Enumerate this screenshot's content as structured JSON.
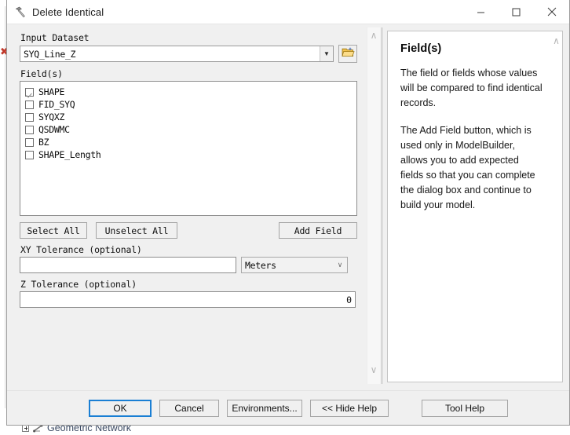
{
  "window": {
    "title": "Delete Identical",
    "icon": "hammer-tool-icon",
    "minimize_label": "—",
    "maximize_label": "☐",
    "close_label": "✕"
  },
  "parameters": {
    "input_dataset": {
      "label": "Input Dataset",
      "value": "SYQ_Line_Z",
      "placeholder": "",
      "browse_icon": "open-folder-icon",
      "caret": "▼"
    },
    "fields": {
      "label": "Field(s)",
      "items": [
        {
          "name": "SHAPE",
          "checked": true
        },
        {
          "name": "FID_SYQ",
          "checked": false
        },
        {
          "name": "SYQXZ",
          "checked": false
        },
        {
          "name": "QSDWMC",
          "checked": false
        },
        {
          "name": "BZ",
          "checked": false
        },
        {
          "name": "SHAPE_Length",
          "checked": false
        }
      ]
    },
    "buttons": {
      "select_all": "Select All",
      "unselect_all": "Unselect All",
      "add_field": "Add Field"
    },
    "xy_tolerance": {
      "label": "XY Tolerance (optional)",
      "value": "",
      "placeholder": "",
      "units_value": "Meters",
      "units_caret": "∨"
    },
    "z_tolerance": {
      "label": "Z Tolerance (optional)",
      "value": "0",
      "placeholder": ""
    },
    "scroll_up": "∧",
    "scroll_down": "∨"
  },
  "help": {
    "title": "Field(s)",
    "paragraph1": "The field or fields whose values will be compared to find identical records.",
    "paragraph2": "The Add Field button, which is used only in ModelBuilder, allows you to add expected fields so that you can complete the dialog box and continue to build your model.",
    "scroll_up": "∧"
  },
  "footer": {
    "ok": "OK",
    "cancel": "Cancel",
    "environments": "Environments...",
    "hide_help": "<< Hide Help",
    "tool_help": "Tool Help"
  },
  "background": {
    "tree_item": "Geometric Network",
    "red_marker": "✖"
  },
  "colors": {
    "accent": "#1a7fd4",
    "dialog_face": "#f0f0f0",
    "field_bg": "#ffffff",
    "border": "#8d8d8d",
    "text": "#101010"
  }
}
